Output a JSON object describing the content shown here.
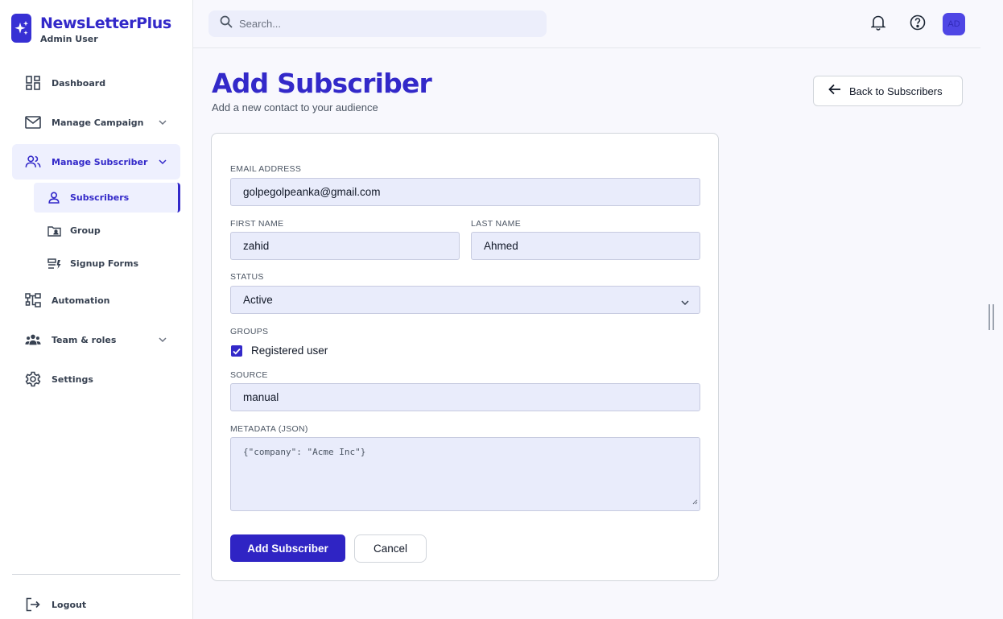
{
  "brand": {
    "name": "NewsLetterPlus",
    "user": "Admin User"
  },
  "sidebar": {
    "items": [
      {
        "label": "Dashboard",
        "icon": "dashboard-icon"
      },
      {
        "label": "Manage Campaign",
        "icon": "mail-icon"
      },
      {
        "label": "Manage Subscriber",
        "icon": "users-icon"
      },
      {
        "label": "Automation",
        "icon": "workflow-icon"
      },
      {
        "label": "Team & roles",
        "icon": "team-icon"
      },
      {
        "label": "Settings",
        "icon": "gear-icon"
      }
    ],
    "sub_items": [
      {
        "label": "Subscribers",
        "icon": "user-icon"
      },
      {
        "label": "Group",
        "icon": "folder-user-icon"
      },
      {
        "label": "Signup Forms",
        "icon": "form-icon"
      }
    ],
    "logout": "Logout"
  },
  "topbar": {
    "search_placeholder": "Search...",
    "avatar": "AD"
  },
  "page": {
    "title": "Add Subscriber",
    "subtitle": "Add a new contact to your audience",
    "back_label": "Back to Subscribers"
  },
  "form": {
    "email_label": "EMAIL ADDRESS",
    "email_value": "golpegolpeanka@gmail.com",
    "first_name_label": "FIRST NAME",
    "first_name_value": "zahid",
    "last_name_label": "LAST NAME",
    "last_name_value": "Ahmed",
    "status_label": "STATUS",
    "status_value": "Active",
    "groups_label": "GROUPS",
    "group_option": "Registered user",
    "group_checked": true,
    "source_label": "SOURCE",
    "source_value": "manual",
    "metadata_label": "METADATA (JSON)",
    "metadata_placeholder": "{\"company\": \"Acme Inc\"}",
    "submit_label": "Add Subscriber",
    "cancel_label": "Cancel"
  },
  "colors": {
    "accent": "#3329c9",
    "active_bg": "#eef0fe",
    "field_bg": "#e9ecfb"
  }
}
